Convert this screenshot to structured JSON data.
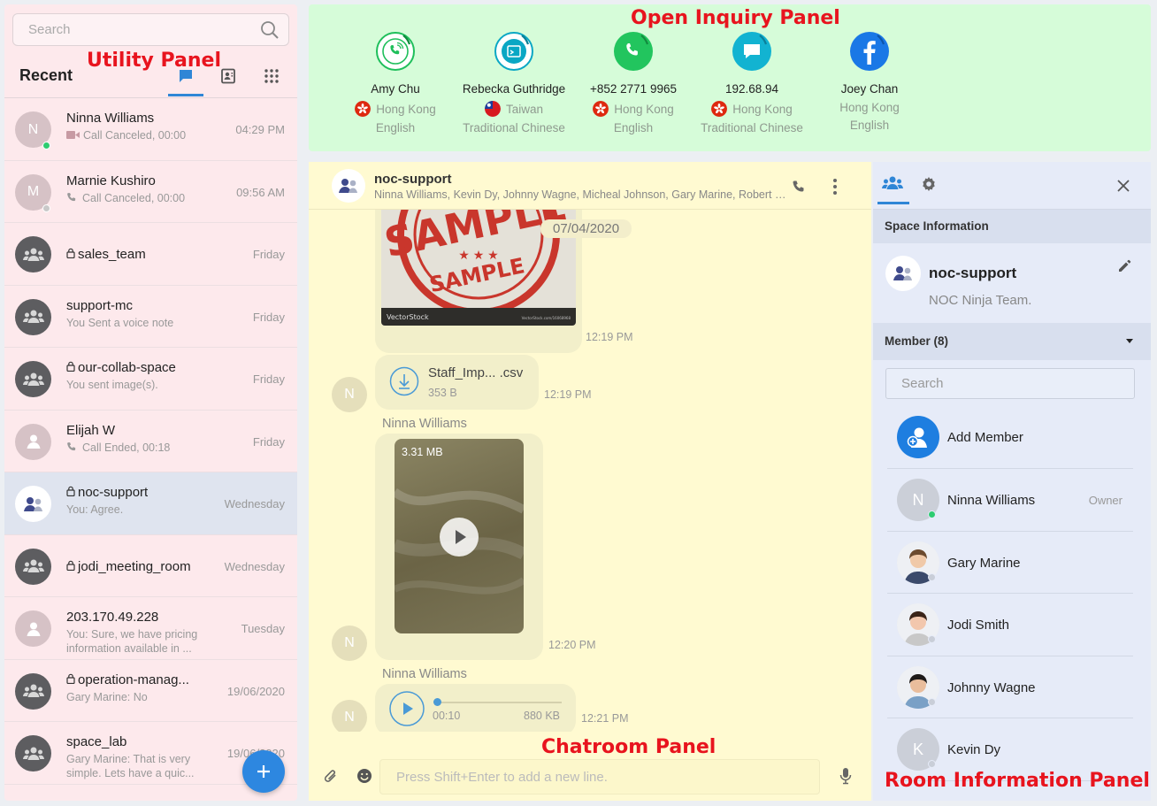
{
  "annotations": {
    "utility": "Utility Panel",
    "inquiry": "Open Inquiry Panel",
    "chatroom": "Chatroom Panel",
    "room_info": "Room Information Panel"
  },
  "utility": {
    "search_placeholder": "Search",
    "recent_label": "Recent",
    "add_label": "+",
    "conversations": [
      {
        "initial": "N",
        "name": "Ninna Williams",
        "sub": "Call Canceled, 00:00",
        "sub_icon": "video-icon",
        "time": "04:29 PM",
        "status": "online",
        "avatar_color": "#d6c2c6"
      },
      {
        "initial": "M",
        "name": "Marnie Kushiro",
        "sub": "Call Canceled, 00:00",
        "sub_icon": "phone-icon",
        "time": "09:56 AM",
        "status": "offline",
        "avatar_color": "#d6c2c6"
      },
      {
        "initial": "",
        "name": "sales_team",
        "locked": true,
        "sub": "",
        "time": "Friday",
        "avatar_color": "#5d5d60"
      },
      {
        "initial": "",
        "name": "support-mc",
        "sub": "You Sent a voice note",
        "time": "Friday",
        "avatar_color": "#5d5d60"
      },
      {
        "initial": "",
        "name": "our-collab-space",
        "locked": true,
        "sub": "You sent image(s).",
        "time": "Friday",
        "avatar_color": "#5d5d60"
      },
      {
        "initial": "",
        "name": "Elijah W",
        "sub": "Call Ended, 00:18",
        "sub_icon": "phone-icon",
        "time": "Friday",
        "avatar_color": "#d6c2c6"
      },
      {
        "initial": "",
        "name": "noc-support",
        "locked": true,
        "sub": "You: Agree.",
        "time": "Wednesday",
        "avatar_color": "#ffffff"
      },
      {
        "initial": "",
        "name": "jodi_meeting_room",
        "locked": true,
        "sub": "",
        "time": "Wednesday",
        "avatar_color": "#5d5d60"
      },
      {
        "initial": "",
        "name": "203.170.49.228",
        "sub": "You: Sure, we have pricing information available in ...",
        "time": "Tuesday",
        "avatar_color": "#d6c2c6"
      },
      {
        "initial": "",
        "name": "operation-manag...",
        "locked": true,
        "sub": "Gary Marine: No",
        "time": "19/06/2020",
        "avatar_color": "#5d5d60"
      },
      {
        "initial": "",
        "name": "space_lab",
        "sub": "Gary Marine: That is very simple. Lets have a quic...",
        "time": "19/06/2020",
        "avatar_color": "#5d5d60"
      }
    ]
  },
  "inquiry": {
    "items": [
      {
        "name": "Amy Chu",
        "region": "Hong Kong",
        "language": "English",
        "channel": "phone-call-icon",
        "color": "#1fbf5b"
      },
      {
        "name": "Rebecka Guthridge",
        "region": "Taiwan",
        "language": "Traditional Chinese",
        "channel": "web-chat-icon",
        "color": "#0aa7c4"
      },
      {
        "name": "+852 2771 9965",
        "region": "Hong Kong",
        "language": "English",
        "channel": "whatsapp-icon",
        "color": "#22c55e"
      },
      {
        "name": "192.68.94",
        "region": "Hong Kong",
        "language": "Traditional Chinese",
        "channel": "chat-bubble-icon",
        "color": "#12b3d1"
      },
      {
        "name": "Joey Chan",
        "region": "Hong Kong",
        "language": "English",
        "channel": "facebook-icon",
        "color": "#1a78e6"
      }
    ]
  },
  "chat": {
    "title": "noc-support",
    "members": "Ninna Williams, Kevin Dy, Johnny Wagne, Micheal Johnson, Gary Marine, Robert Wong",
    "date_chip": "07/04/2020",
    "image_caption_left": "VectorStock",
    "image_caption_right": "VectorStock.com/16068968",
    "image_text_top": "SAMPLE",
    "image_text_bottom": "SAMPLE",
    "messages": {
      "image_time": "12:19 PM",
      "file_name": "Staff_Imp... .csv",
      "file_size": "353 B",
      "file_time": "12:19 PM",
      "sender1": "Ninna Williams",
      "video_size": "3.31 MB",
      "video_time": "12:20 PM",
      "sender2": "Ninna Williams",
      "audio_position": "00:10",
      "audio_size": "880 KB",
      "audio_time": "12:21 PM",
      "avatar_initial": "N"
    },
    "input_placeholder": "Press Shift+Enter to add a new line."
  },
  "room": {
    "space_info_label": "Space Information",
    "space_name": "noc-support",
    "space_desc": "NOC Ninja Team.",
    "member_label": "Member (8)",
    "search_placeholder": "Search",
    "add_member_label": "Add Member",
    "members": [
      {
        "name": "Ninna Williams",
        "role": "Owner",
        "initial": "N",
        "status": "online"
      },
      {
        "name": "Gary Marine",
        "role": "",
        "initial": "",
        "status": "offline"
      },
      {
        "name": "Jodi Smith",
        "role": "",
        "initial": "",
        "status": "offline"
      },
      {
        "name": "Johnny Wagne",
        "role": "",
        "initial": "",
        "status": "offline"
      },
      {
        "name": "Kevin Dy",
        "role": "",
        "initial": "K",
        "status": "offline"
      }
    ]
  }
}
